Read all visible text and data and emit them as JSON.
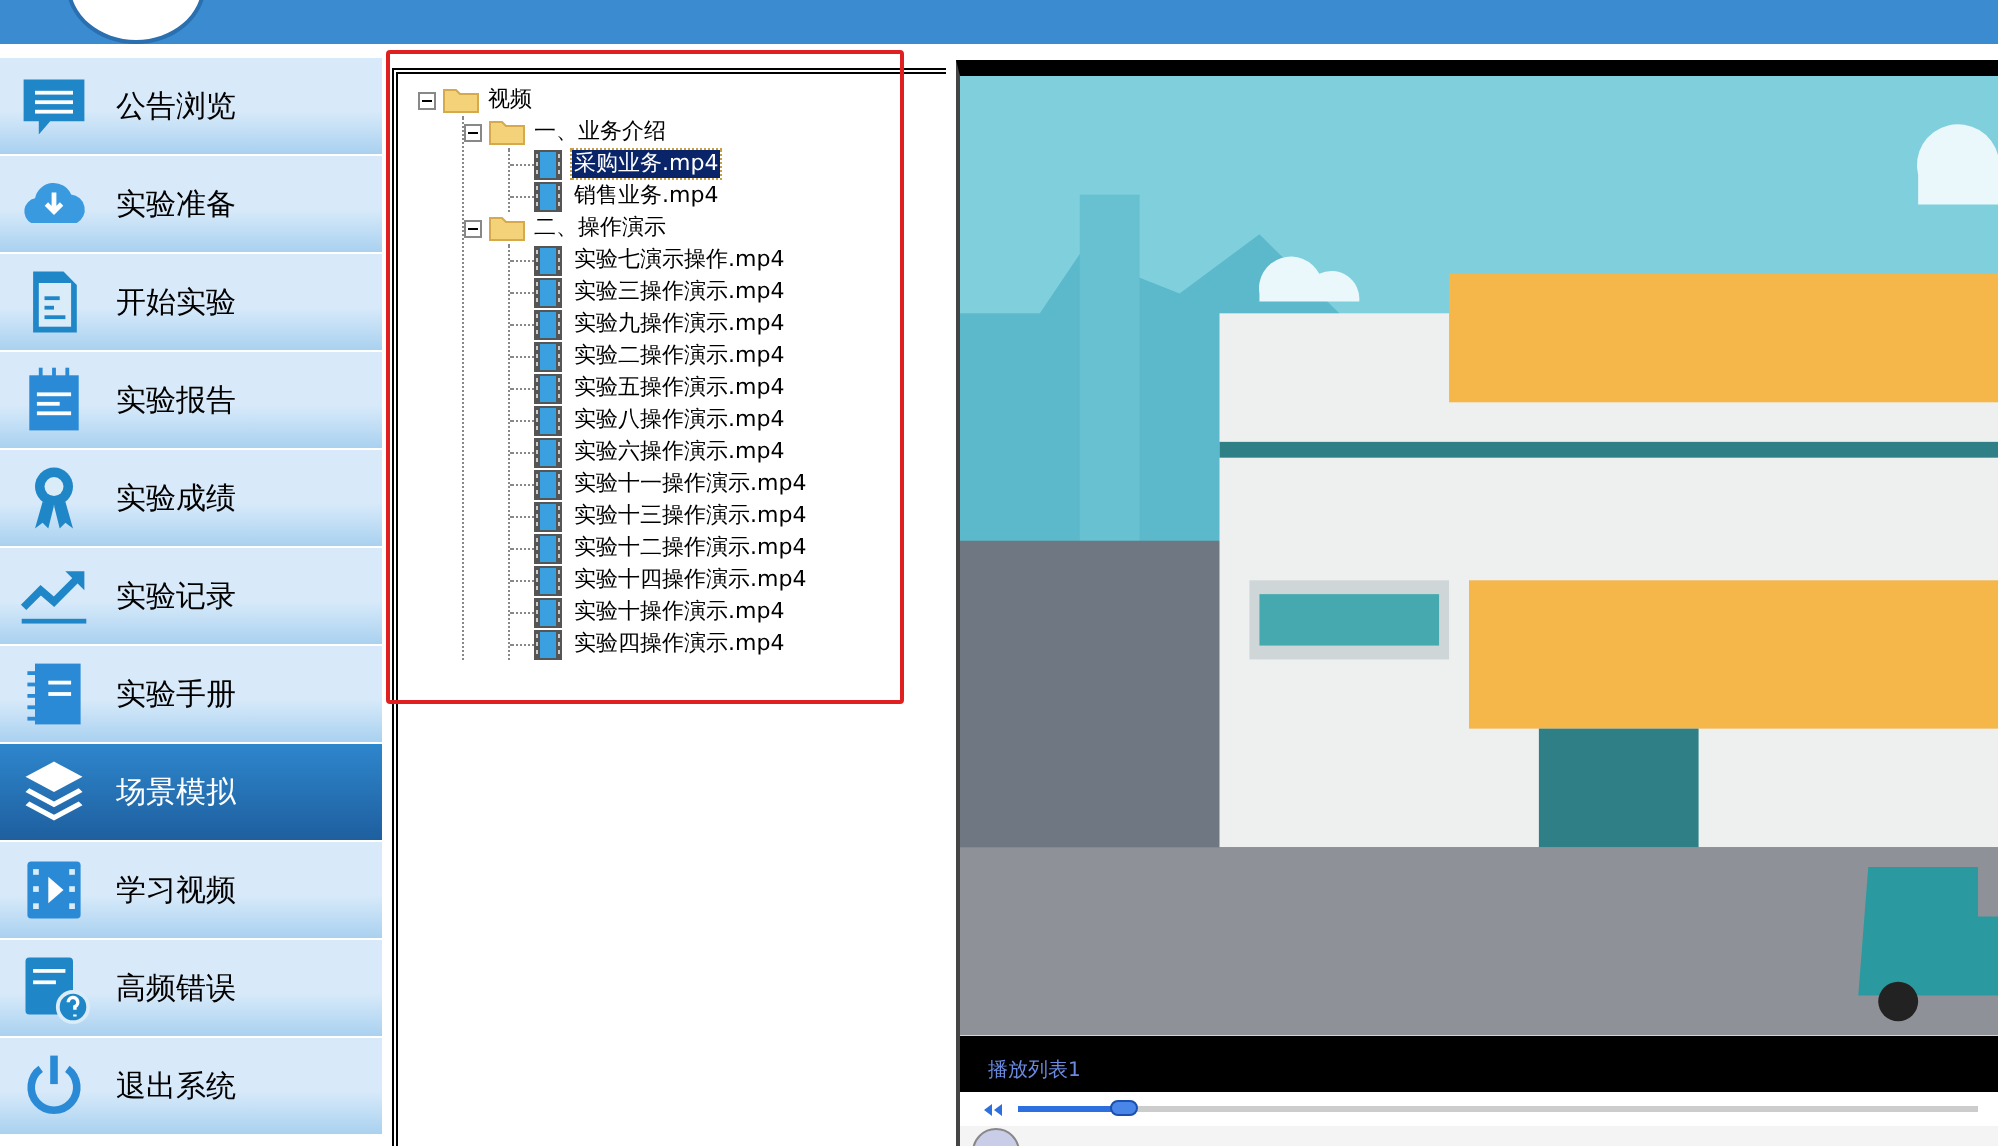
{
  "sidebar": {
    "items": [
      {
        "label": "公告浏览",
        "selected": false
      },
      {
        "label": "实验准备",
        "selected": false
      },
      {
        "label": "开始实验",
        "selected": false
      },
      {
        "label": "实验报告",
        "selected": false
      },
      {
        "label": "实验成绩",
        "selected": false
      },
      {
        "label": "实验记录",
        "selected": false
      },
      {
        "label": "实验手册",
        "selected": false
      },
      {
        "label": "场景模拟",
        "selected": true
      },
      {
        "label": "学习视频",
        "selected": false
      },
      {
        "label": "高频错误",
        "selected": false
      },
      {
        "label": "退出系统",
        "selected": false
      }
    ]
  },
  "tree": [
    {
      "label": "视频",
      "expanded": true,
      "selected": false,
      "children": [
        {
          "label": "一、业务介绍",
          "expanded": true,
          "selected": false,
          "children": [
            {
              "label": "采购业务.mp4",
              "selected": true
            },
            {
              "label": "销售业务.mp4",
              "selected": false
            }
          ]
        },
        {
          "label": "二、操作演示",
          "expanded": true,
          "selected": false,
          "children": [
            {
              "label": "实验七演示操作.mp4",
              "selected": false
            },
            {
              "label": "实验三操作演示.mp4",
              "selected": false
            },
            {
              "label": "实验九操作演示.mp4",
              "selected": false
            },
            {
              "label": "实验二操作演示.mp4",
              "selected": false
            },
            {
              "label": "实验五操作演示.mp4",
              "selected": false
            },
            {
              "label": "实验八操作演示.mp4",
              "selected": false
            },
            {
              "label": "实验六操作演示.mp4",
              "selected": false
            },
            {
              "label": "实验十一操作演示.mp4",
              "selected": false
            },
            {
              "label": "实验十三操作演示.mp4",
              "selected": false
            },
            {
              "label": "实验十二操作演示.mp4",
              "selected": false
            },
            {
              "label": "实验十四操作演示.mp4",
              "selected": false
            },
            {
              "label": "实验十操作演示.mp4",
              "selected": false
            },
            {
              "label": "实验四操作演示.mp4",
              "selected": false
            }
          ]
        }
      ]
    }
  ],
  "player": {
    "playlist_label": "播放列表1",
    "seek": {
      "level": 0.11
    }
  }
}
